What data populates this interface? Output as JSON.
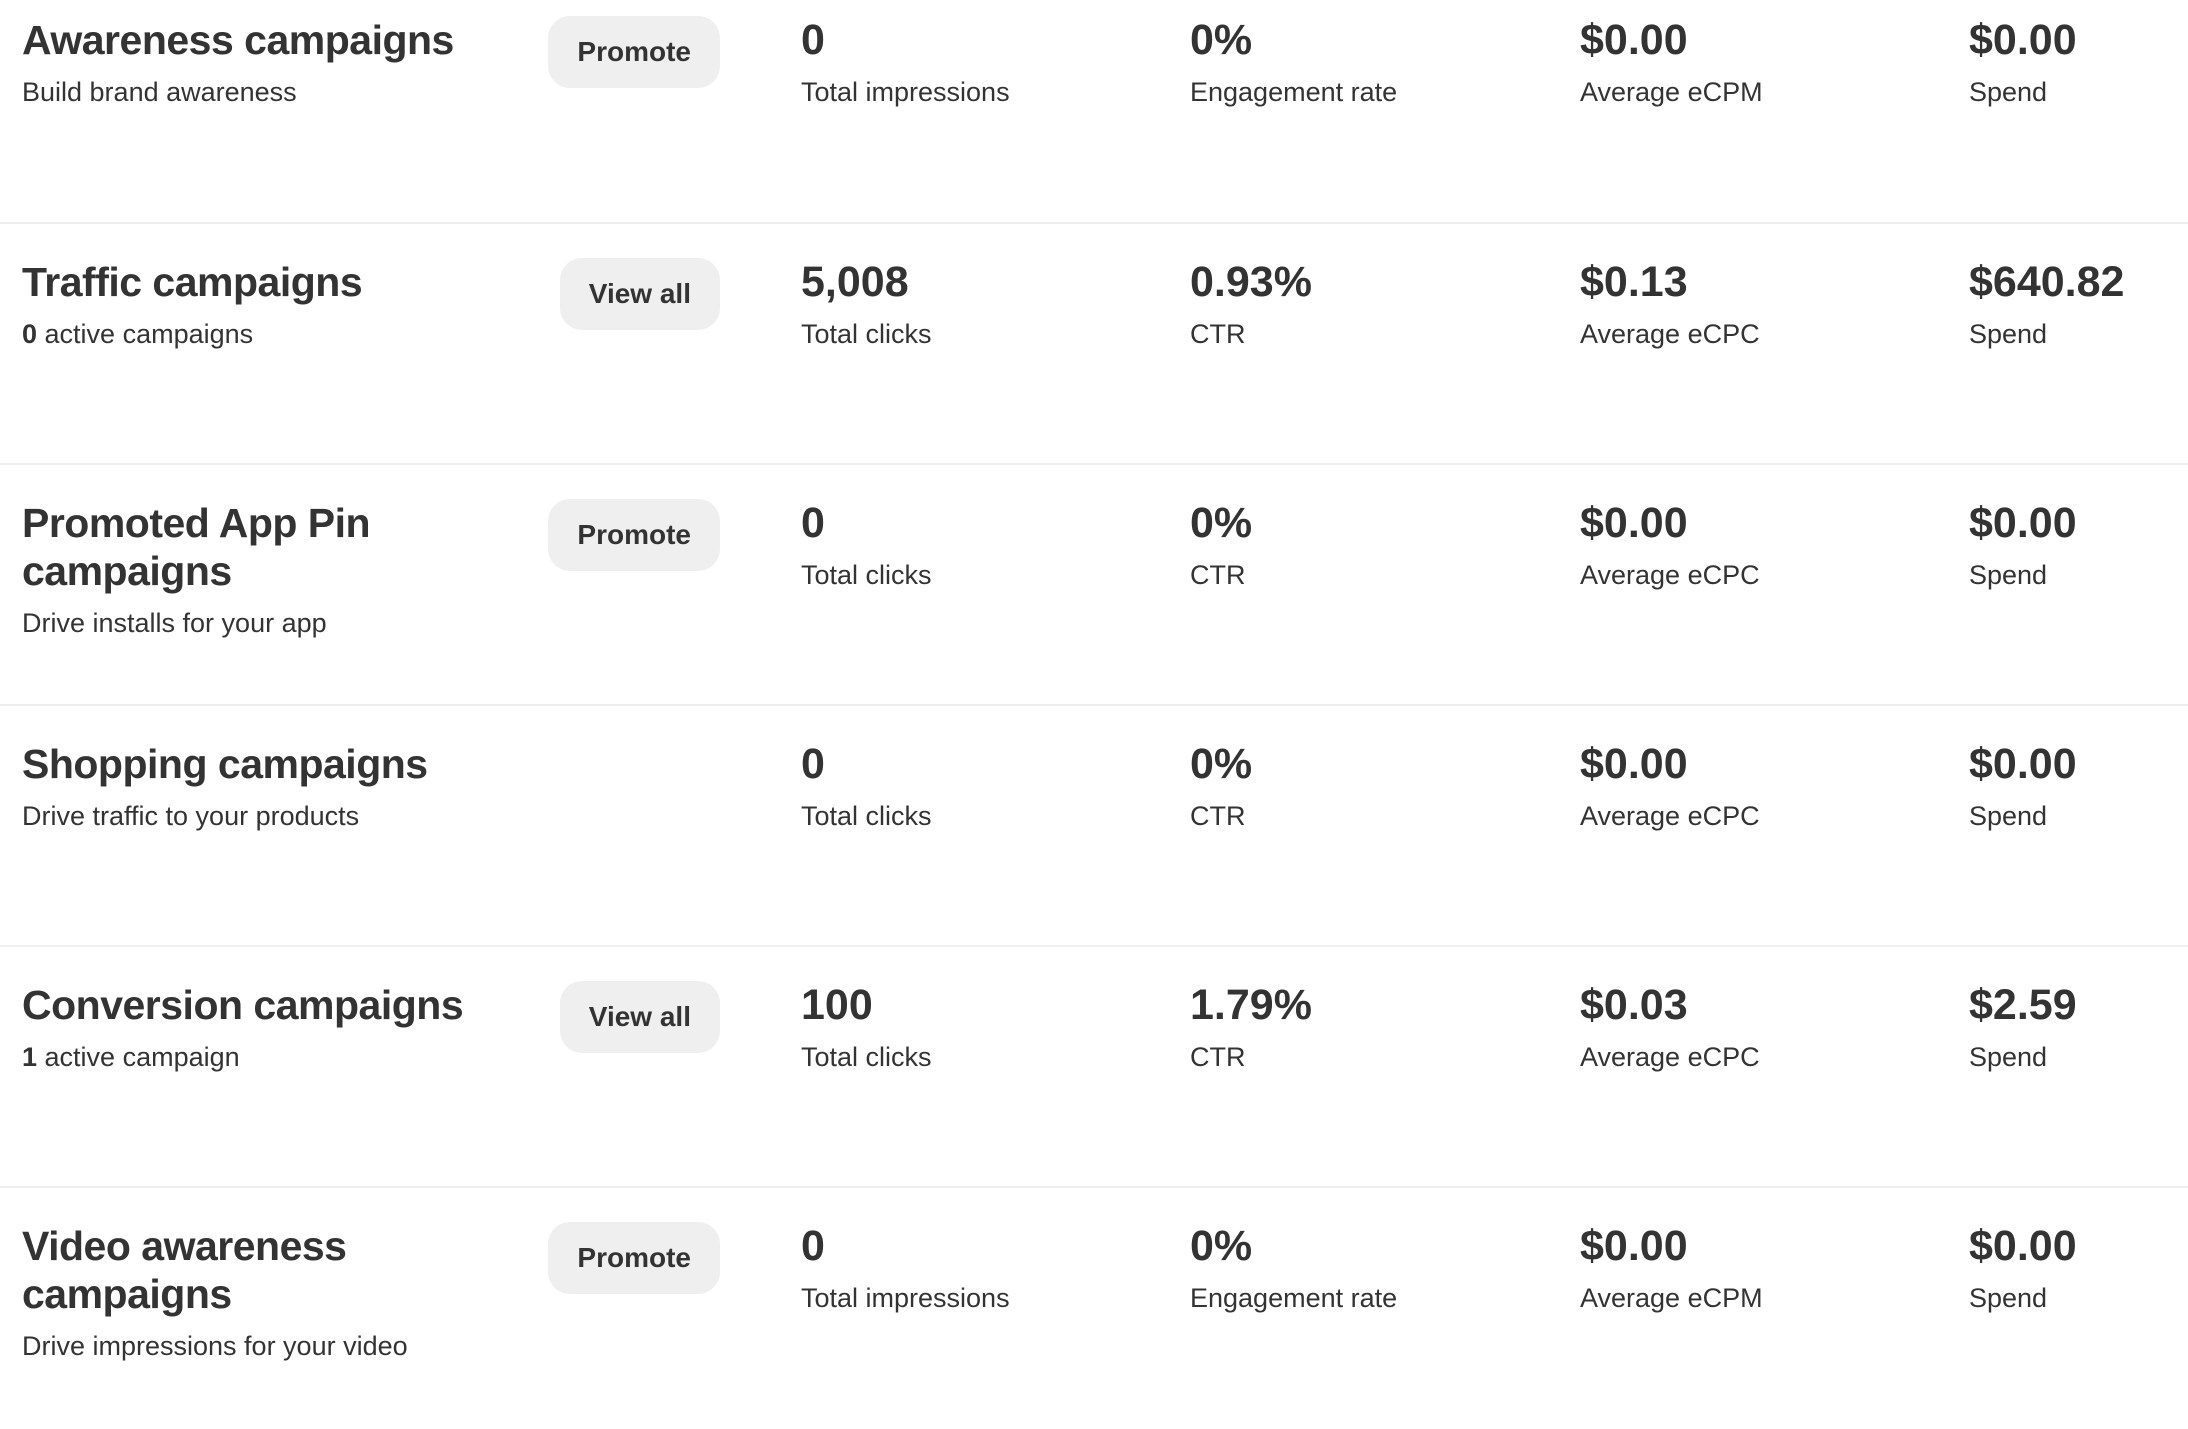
{
  "campaigns": [
    {
      "title": "Awareness campaigns",
      "subtitle_count": "",
      "subtitle": "Build brand awareness",
      "button": "Promote",
      "metrics": [
        {
          "value": "0",
          "label": "Total impressions"
        },
        {
          "value": "0%",
          "label": "Engagement rate"
        },
        {
          "value": "$0.00",
          "label": "Average eCPM"
        },
        {
          "value": "$0.00",
          "label": "Spend"
        }
      ]
    },
    {
      "title": "Traffic campaigns",
      "subtitle_count": "0",
      "subtitle": " active campaigns",
      "button": "View all",
      "metrics": [
        {
          "value": "5,008",
          "label": "Total clicks"
        },
        {
          "value": "0.93%",
          "label": "CTR"
        },
        {
          "value": "$0.13",
          "label": "Average eCPC"
        },
        {
          "value": "$640.82",
          "label": "Spend"
        }
      ]
    },
    {
      "title": "Promoted App Pin campaigns",
      "subtitle_count": "",
      "subtitle": "Drive installs for your app",
      "button": "Promote",
      "metrics": [
        {
          "value": "0",
          "label": "Total clicks"
        },
        {
          "value": "0%",
          "label": "CTR"
        },
        {
          "value": "$0.00",
          "label": "Average eCPC"
        },
        {
          "value": "$0.00",
          "label": "Spend"
        }
      ]
    },
    {
      "title": "Shopping campaigns",
      "subtitle_count": "",
      "subtitle": "Drive traffic to your products",
      "button": null,
      "metrics": [
        {
          "value": "0",
          "label": "Total clicks"
        },
        {
          "value": "0%",
          "label": "CTR"
        },
        {
          "value": "$0.00",
          "label": "Average eCPC"
        },
        {
          "value": "$0.00",
          "label": "Spend"
        }
      ]
    },
    {
      "title": "Conversion campaigns",
      "subtitle_count": "1",
      "subtitle": " active campaign",
      "button": "View all",
      "metrics": [
        {
          "value": "100",
          "label": "Total clicks"
        },
        {
          "value": "1.79%",
          "label": "CTR"
        },
        {
          "value": "$0.03",
          "label": "Average eCPC"
        },
        {
          "value": "$2.59",
          "label": "Spend"
        }
      ]
    },
    {
      "title": "Video awareness campaigns",
      "subtitle_count": "",
      "subtitle": "Drive impressions for your video",
      "button": "Promote",
      "metrics": [
        {
          "value": "0",
          "label": "Total impressions"
        },
        {
          "value": "0%",
          "label": "Engagement rate"
        },
        {
          "value": "$0.00",
          "label": "Average eCPM"
        },
        {
          "value": "$0.00",
          "label": "Spend"
        }
      ]
    }
  ]
}
